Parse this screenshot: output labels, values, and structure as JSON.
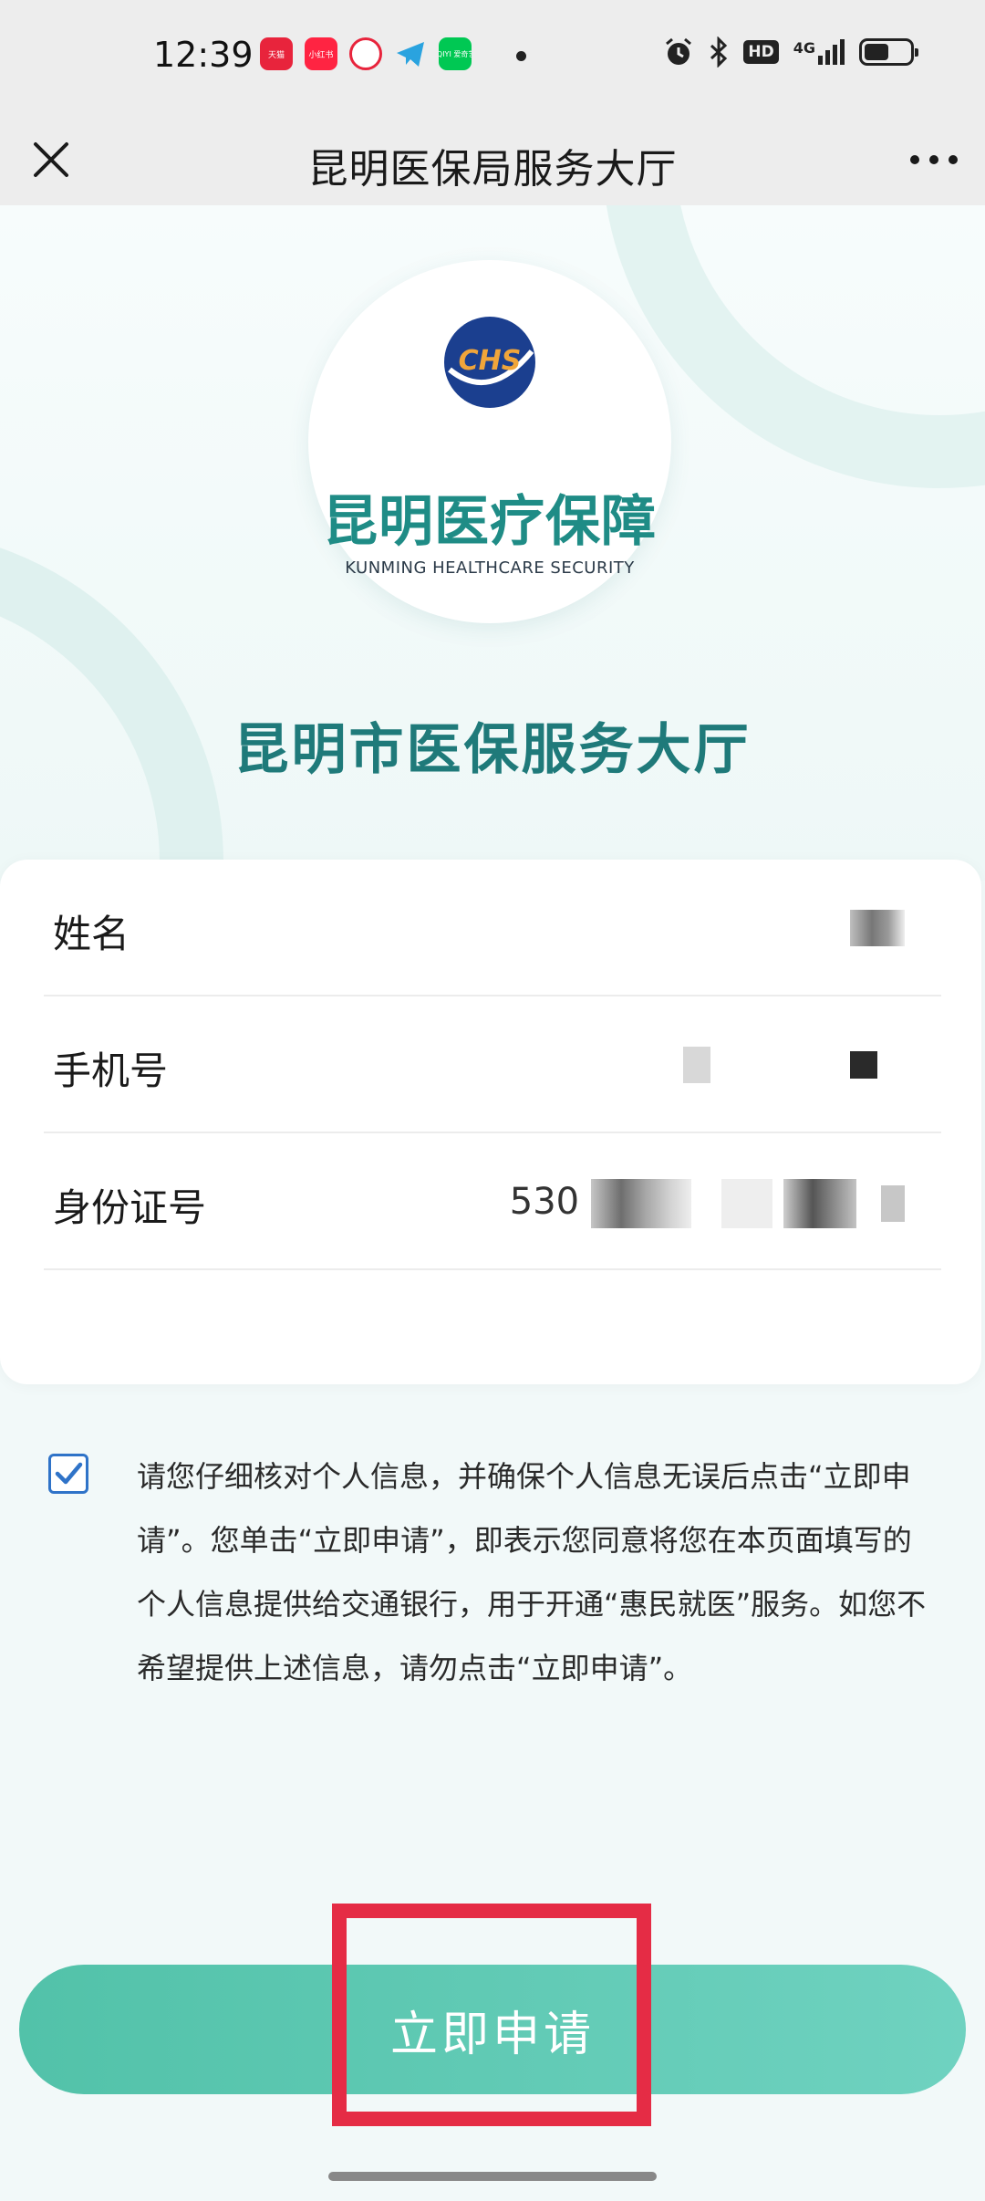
{
  "status_bar": {
    "time": "12:39",
    "app_icons": [
      {
        "name": "tmall-icon",
        "label": "天猫",
        "color": "#e8243c"
      },
      {
        "name": "xiaohongshu-icon",
        "label": "小红书",
        "color": "#ff2442"
      },
      {
        "name": "app-red-icon",
        "label": "",
        "color": "#e8243c"
      },
      {
        "name": "telegram-icon",
        "label": "",
        "color": "#2aa3df"
      },
      {
        "name": "iqiyi-icon",
        "label": "iQIYI 爱奇艺",
        "color": "#00c853"
      }
    ],
    "hd_label": "HD",
    "network_label": "4G",
    "battery_level": 0.55
  },
  "title_bar": {
    "title": "昆明医保局服务大厅"
  },
  "hero": {
    "logo_badge": "CHS",
    "logo_cn": "昆明医疗保障",
    "logo_en": "KUNMING HEALTHCARE SECURITY",
    "hall_title": "昆明市医保服务大厅"
  },
  "form": {
    "rows": [
      {
        "label": "姓名",
        "value": ""
      },
      {
        "label": "手机号",
        "value": ""
      },
      {
        "label": "身份证号",
        "value": "530"
      }
    ]
  },
  "agreement": {
    "checked": true,
    "text": "请您仔细核对个人信息，并确保个人信息无误后点击“立即申请”。您单击“立即申请”，即表示您同意将您在本页面填写的个人信息提供给交通银行，用于开通“惠民就医”服务。如您不希望提供上述信息，请勿点击“立即申请”。"
  },
  "apply_button": {
    "label": "立即申请"
  },
  "colors": {
    "accent": "#1f7a7a",
    "button_start": "#52c2a9",
    "button_end": "#6fd2c0",
    "highlight_frame": "#e52c45",
    "checkbox": "#2f73c8"
  }
}
